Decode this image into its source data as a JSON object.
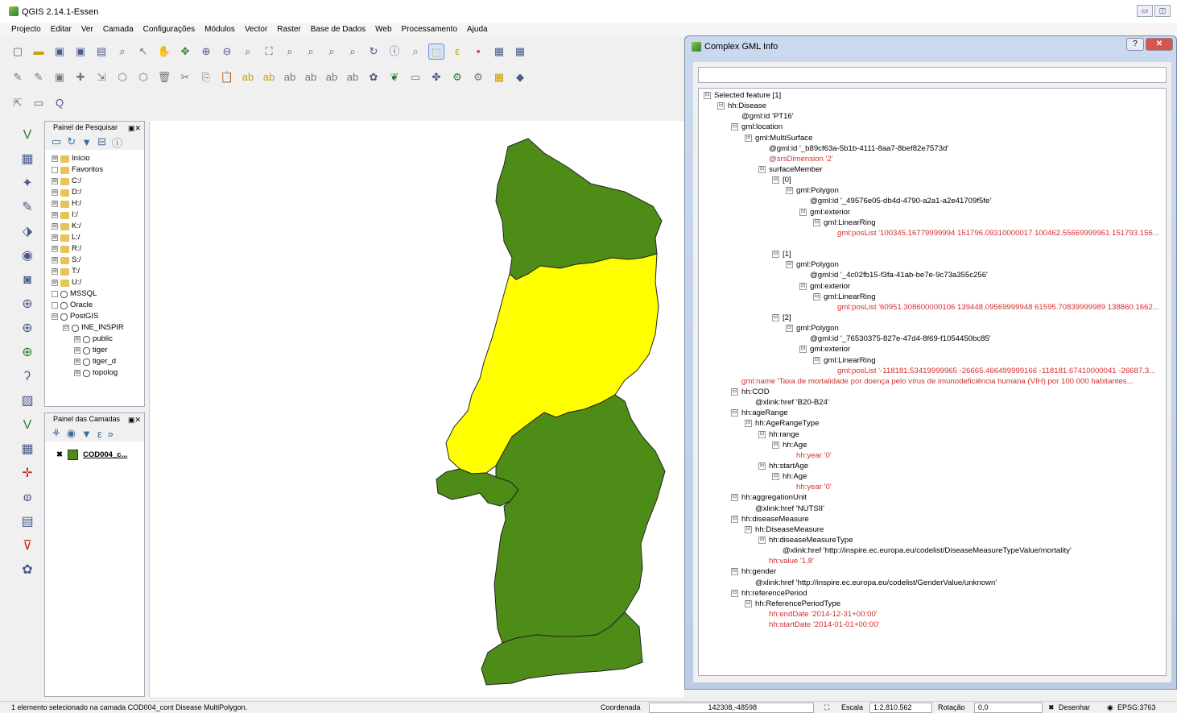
{
  "app": {
    "title": "QGIS 2.14.1-Essen"
  },
  "menu": [
    "Projecto",
    "Editar",
    "Ver",
    "Camada",
    "Configurações",
    "Módulos",
    "Vector",
    "Raster",
    "Base de Dados",
    "Web",
    "Processamento",
    "Ajuda"
  ],
  "browser_panel": {
    "title": "Painel de Pesquisar",
    "items": [
      {
        "label": "Início",
        "icon": "folder-icon",
        "expander": "⊞"
      },
      {
        "label": "Favoritos",
        "icon": "star-icon",
        "expander": ""
      },
      {
        "label": "C:/",
        "icon": "folder-icon",
        "expander": "⊞"
      },
      {
        "label": "D:/",
        "icon": "folder-icon",
        "expander": "⊞"
      },
      {
        "label": "H:/",
        "icon": "folder-icon",
        "expander": "⊞"
      },
      {
        "label": "I:/",
        "icon": "folder-icon",
        "expander": "⊞"
      },
      {
        "label": "K:/",
        "icon": "folder-icon",
        "expander": "⊞"
      },
      {
        "label": "L:/",
        "icon": "folder-icon",
        "expander": "⊞"
      },
      {
        "label": "R:/",
        "icon": "folder-icon",
        "expander": "⊞"
      },
      {
        "label": "S:/",
        "icon": "folder-icon",
        "expander": "⊞"
      },
      {
        "label": "T:/",
        "icon": "folder-icon",
        "expander": "⊞"
      },
      {
        "label": "U:/",
        "icon": "folder-icon",
        "expander": "⊞"
      },
      {
        "label": "MSSQL",
        "icon": "mssql-icon",
        "expander": ""
      },
      {
        "label": "Oracle",
        "icon": "oracle-icon",
        "expander": ""
      },
      {
        "label": "PostGIS",
        "icon": "postgis-icon",
        "expander": "⊟"
      },
      {
        "label": "INE_INSPIR",
        "icon": "connection-icon",
        "expander": "⊟",
        "indent": 1
      },
      {
        "label": "public",
        "icon": "schema-icon",
        "expander": "⊞",
        "indent": 2
      },
      {
        "label": "tiger",
        "icon": "schema-icon",
        "expander": "⊞",
        "indent": 2
      },
      {
        "label": "tiger_d",
        "icon": "schema-icon",
        "expander": "⊞",
        "indent": 2
      },
      {
        "label": "topolog",
        "icon": "schema-icon",
        "expander": "⊞",
        "indent": 2
      }
    ]
  },
  "layers_panel": {
    "title": "Painel das Camadas",
    "layer": "COD004_c..."
  },
  "status": {
    "message": "1 elemento selecionado na camada COD004_cont Disease MultiPolygon.",
    "coord_label": "Coordenada",
    "coord_value": "142308,-48598",
    "scale_label": "Escala",
    "scale_value": "1:2.810.562",
    "rotation_label": "Rotação",
    "rotation_value": "0,0",
    "render_label": "Desenhar",
    "crs": "EPSG:3763"
  },
  "colors": {
    "green": "#4d8c17",
    "yellow": "#ffff00",
    "red_text": "#d32f2f"
  },
  "dialog": {
    "title": "Complex GML Info",
    "help": "?",
    "close": "✕",
    "nodes": [
      {
        "d": 0,
        "e": "⊟",
        "t": "Selected feature [1]",
        "c": ""
      },
      {
        "d": 1,
        "e": "⊟",
        "t": "hh:Disease",
        "c": ""
      },
      {
        "d": 2,
        "e": "",
        "t": "@gml:id 'PT16'",
        "c": ""
      },
      {
        "d": 2,
        "e": "⊟",
        "t": "gml:location",
        "c": ""
      },
      {
        "d": 3,
        "e": "⊟",
        "t": "gml:MultiSurface",
        "c": ""
      },
      {
        "d": 4,
        "e": "",
        "t": "@gml:id '_b89cf63a-5b1b-4111-8aa7-8bef82e7573d'",
        "c": ""
      },
      {
        "d": 4,
        "e": "",
        "t": "@srsDimension '2'",
        "c": "red"
      },
      {
        "d": 4,
        "e": "⊟",
        "t": "surfaceMember",
        "c": ""
      },
      {
        "d": 5,
        "e": "⊟",
        "t": "[0]",
        "c": ""
      },
      {
        "d": 6,
        "e": "⊟",
        "t": "gml:Polygon",
        "c": ""
      },
      {
        "d": 7,
        "e": "",
        "t": "@gml:id '_49576e05-db4d-4790-a2a1-a2e41709f5fe'",
        "c": ""
      },
      {
        "d": 7,
        "e": "⊟",
        "t": "gml:exterior",
        "c": ""
      },
      {
        "d": 8,
        "e": "⊟",
        "t": "gml:LinearRing",
        "c": ""
      },
      {
        "d": 9,
        "e": "",
        "t": "gml:posList '100345.16779999994 151796.09310000017 100462.55669999961 151793.156...",
        "c": "red"
      },
      {
        "d": 9,
        "e": "",
        "t": "",
        "c": ""
      },
      {
        "d": 5,
        "e": "⊟",
        "t": "[1]",
        "c": ""
      },
      {
        "d": 6,
        "e": "⊟",
        "t": "gml:Polygon",
        "c": ""
      },
      {
        "d": 7,
        "e": "",
        "t": "@gml:id '_4c02fb15-f3fa-41ab-be7e-9c73a355c256'",
        "c": ""
      },
      {
        "d": 7,
        "e": "⊟",
        "t": "gml:exterior",
        "c": ""
      },
      {
        "d": 8,
        "e": "⊟",
        "t": "gml:LinearRing",
        "c": ""
      },
      {
        "d": 9,
        "e": "",
        "t": "gml:posList '60951.308600000106 139448.09569999948 61595.70839999989 138860.1662...",
        "c": "red"
      },
      {
        "d": 5,
        "e": "⊟",
        "t": "[2]",
        "c": ""
      },
      {
        "d": 6,
        "e": "⊟",
        "t": "gml:Polygon",
        "c": ""
      },
      {
        "d": 7,
        "e": "",
        "t": "@gml:id '_76530375-827e-47d4-8f69-f1054450bc85'",
        "c": ""
      },
      {
        "d": 7,
        "e": "⊟",
        "t": "gml:exterior",
        "c": ""
      },
      {
        "d": 8,
        "e": "⊟",
        "t": "gml:LinearRing",
        "c": ""
      },
      {
        "d": 9,
        "e": "",
        "t": "gml:posList '-118181.53419999965 -26665.466499999166 -118181.67410000041 -26687.3...",
        "c": "red"
      },
      {
        "d": 2,
        "e": "",
        "t": "gml:name 'Taxa de mortalidade por doença pelo vírus de imunodeficiência humana (VIH) por 100 000 habitantes...",
        "c": "red"
      },
      {
        "d": 2,
        "e": "⊟",
        "t": "hh:COD",
        "c": ""
      },
      {
        "d": 3,
        "e": "",
        "t": "@xlink:href 'B20-B24'",
        "c": ""
      },
      {
        "d": 2,
        "e": "⊟",
        "t": "hh:ageRange",
        "c": ""
      },
      {
        "d": 3,
        "e": "⊟",
        "t": "hh:AgeRangeType",
        "c": ""
      },
      {
        "d": 4,
        "e": "⊟",
        "t": "hh:range",
        "c": ""
      },
      {
        "d": 5,
        "e": "⊟",
        "t": "hh:Age",
        "c": ""
      },
      {
        "d": 6,
        "e": "",
        "t": "hh:year '0'",
        "c": "red"
      },
      {
        "d": 4,
        "e": "⊟",
        "t": "hh:startAge",
        "c": ""
      },
      {
        "d": 5,
        "e": "⊟",
        "t": "hh:Age",
        "c": ""
      },
      {
        "d": 6,
        "e": "",
        "t": "hh:year '0'",
        "c": "red"
      },
      {
        "d": 2,
        "e": "⊟",
        "t": "hh:aggregationUnit",
        "c": ""
      },
      {
        "d": 3,
        "e": "",
        "t": "@xlink:href 'NUTSII'",
        "c": ""
      },
      {
        "d": 2,
        "e": "⊟",
        "t": "hh:diseaseMeasure",
        "c": ""
      },
      {
        "d": 3,
        "e": "⊟",
        "t": "hh:DiseaseMeasure",
        "c": ""
      },
      {
        "d": 4,
        "e": "⊟",
        "t": "hh:diseaseMeasureType",
        "c": ""
      },
      {
        "d": 5,
        "e": "",
        "t": "@xlink:href 'http://inspire.ec.europa.eu/codelist/DiseaseMeasureTypeValue/mortality'",
        "c": ""
      },
      {
        "d": 4,
        "e": "",
        "t": "hh:value '1.8'",
        "c": "red"
      },
      {
        "d": 2,
        "e": "⊟",
        "t": "hh:gender",
        "c": ""
      },
      {
        "d": 3,
        "e": "",
        "t": "@xlink:href 'http://inspire.ec.europa.eu/codelist/GenderValue/unknown'",
        "c": ""
      },
      {
        "d": 2,
        "e": "⊟",
        "t": "hh:referencePeriod",
        "c": ""
      },
      {
        "d": 3,
        "e": "⊟",
        "t": "hh:ReferencePeriodType",
        "c": ""
      },
      {
        "d": 4,
        "e": "",
        "t": "hh:endDate '2014-12-31+00:00'",
        "c": "red"
      },
      {
        "d": 4,
        "e": "",
        "t": "hh:startDate '2014-01-01+00:00'",
        "c": "red"
      }
    ]
  }
}
